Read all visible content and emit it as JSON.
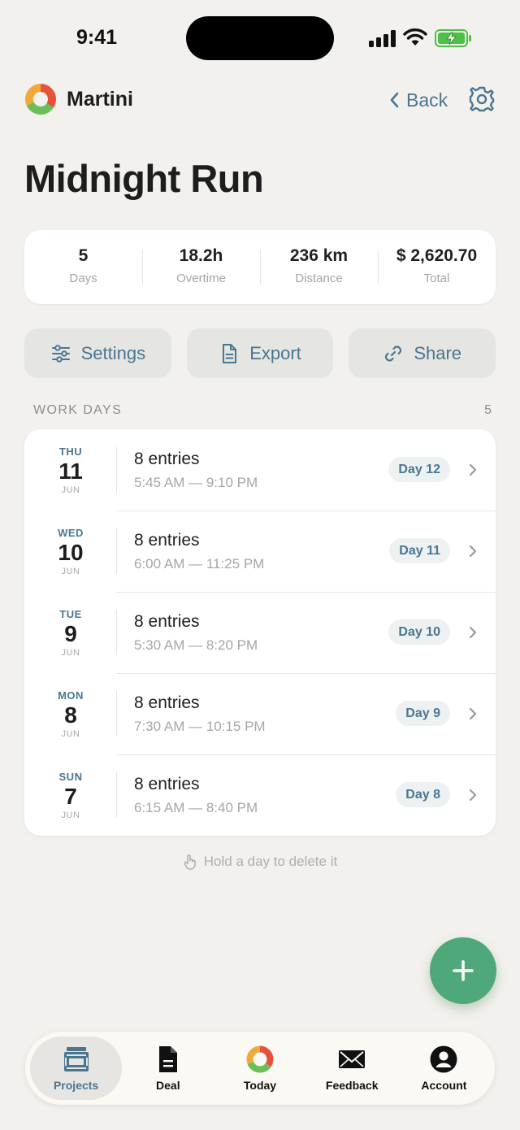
{
  "status_bar": {
    "time": "9:41"
  },
  "header": {
    "brand": "Martini",
    "back_label": "Back"
  },
  "page_title": "Midnight Run",
  "stats": [
    {
      "value": "5",
      "label": "Days"
    },
    {
      "value": "18.2h",
      "label": "Overtime"
    },
    {
      "value": "236 km",
      "label": "Distance"
    },
    {
      "value": "$ 2,620.70",
      "label": "Total"
    }
  ],
  "actions": {
    "settings": "Settings",
    "export": "Export",
    "share": "Share"
  },
  "section": {
    "title": "WORK DAYS",
    "count": "5"
  },
  "days": [
    {
      "weekday": "THU",
      "day": "11",
      "month": "JUN",
      "entries": "8 entries",
      "range": "5:45 AM — 9:10 PM",
      "badge": "Day 12"
    },
    {
      "weekday": "WED",
      "day": "10",
      "month": "JUN",
      "entries": "8 entries",
      "range": "6:00 AM — 11:25 PM",
      "badge": "Day 11"
    },
    {
      "weekday": "TUE",
      "day": "9",
      "month": "JUN",
      "entries": "8 entries",
      "range": "5:30 AM — 8:20 PM",
      "badge": "Day 10"
    },
    {
      "weekday": "MON",
      "day": "8",
      "month": "JUN",
      "entries": "8 entries",
      "range": "7:30 AM — 10:15 PM",
      "badge": "Day 9"
    },
    {
      "weekday": "SUN",
      "day": "7",
      "month": "JUN",
      "entries": "8 entries",
      "range": "6:15 AM — 8:40 PM",
      "badge": "Day 8"
    }
  ],
  "hint": "Hold a day to delete it",
  "tabs": {
    "projects": "Projects",
    "deal": "Deal",
    "today": "Today",
    "feedback": "Feedback",
    "account": "Account"
  },
  "colors": {
    "accent": "#4a7690",
    "fab": "#4fa879",
    "background": "#f3f1ee"
  }
}
